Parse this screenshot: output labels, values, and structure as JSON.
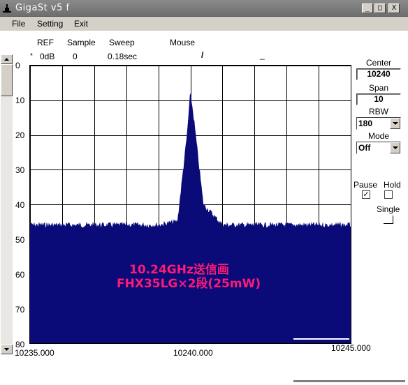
{
  "window": {
    "title": "GigaSt v5 f",
    "minimize": "_",
    "maximize": "□",
    "close": "X"
  },
  "menu": {
    "file": "File",
    "setting": "Setting",
    "exit": "Exit"
  },
  "header": {
    "ref_label": "REF",
    "sample_label": "Sample",
    "sweep_label": "Sweep",
    "mouse_label": "Mouse",
    "ref_value": "0dB",
    "sample_value": "0",
    "sweep_value": "0.18sec",
    "marker": "*",
    "mouse_glyph1": "/",
    "mouse_glyph2": "_"
  },
  "controls": {
    "center_label": "Center",
    "center_value": "10240",
    "span_label": "Span",
    "span_value": "10",
    "rbw_label": "RBW",
    "rbw_value": "180",
    "mode_label": "Mode",
    "mode_value": "Off",
    "pause_label": "Pause",
    "pause_checked": "✓",
    "hold_label": "Hold",
    "single_label": "Single"
  },
  "annotation": {
    "line1": "10.24GHz送信画",
    "line2": "FHX35LG×2段(25mW)"
  },
  "colors": {
    "trace": "#0a0a78",
    "annotation": "#ff1a75",
    "titlebar": "#7a7a7a"
  },
  "chart_data": {
    "type": "area",
    "y_tick_labels": [
      "0",
      "10",
      "20",
      "30",
      "40",
      "50",
      "60",
      "70",
      "80"
    ],
    "x_tick_labels": [
      "10235.000",
      "10240.000",
      "10245.000"
    ],
    "ylim": [
      0,
      80
    ],
    "y_inverted": true,
    "xlim": [
      10235.0,
      10245.0
    ],
    "grid": true,
    "series": [
      {
        "x": [
          10235.0,
          10236.0,
          10237.0,
          10238.0,
          10239.0,
          10239.6,
          10239.9,
          10240.0,
          10240.1,
          10240.4,
          10241.0,
          10242.0,
          10243.0,
          10244.0,
          10245.0
        ],
        "values": [
          46,
          46,
          46,
          46,
          46,
          45,
          20,
          8,
          15,
          40,
          46,
          46,
          46,
          46,
          46
        ]
      }
    ]
  }
}
